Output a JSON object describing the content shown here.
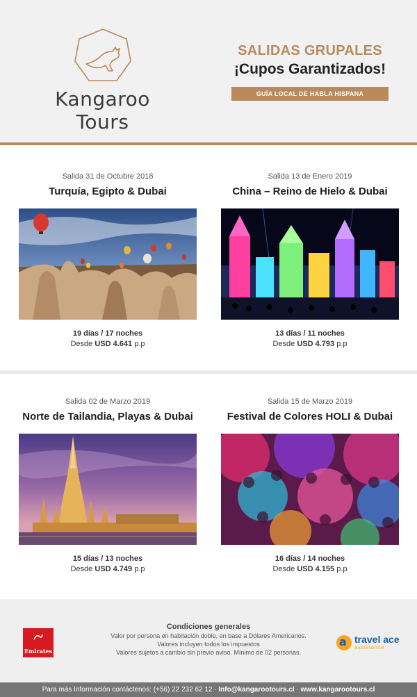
{
  "brand": {
    "name": "Kangaroo Tours"
  },
  "promo": {
    "title": "SALIDAS GRUPALES",
    "subtitle": "¡Cupos Garantizados!",
    "badge": "GUÍA LOCAL DE HABLA HISPANA"
  },
  "tours": [
    {
      "date": "Salida 31 de Octubre 2018",
      "title": "Turquía, Egipto & Dubai",
      "duration": "19 días / 17 noches",
      "price_prefix": "Desde",
      "price": "USD 4.641",
      "price_suffix": "p.p",
      "image": "cappadocia-balloons"
    },
    {
      "date": "Salida 13 de Enero 2019",
      "title": "China – Reino de Hielo & Dubai",
      "duration": "13 días / 11 noches",
      "price_prefix": "Desde",
      "price": "USD 4.793",
      "price_suffix": "p.p",
      "image": "ice-castle-night"
    },
    {
      "date": "Salida 02 de Marzo 2019",
      "title": "Norte de Tailandia, Playas & Dubai",
      "duration": "15 días / 13 noches",
      "price_prefix": "Desde",
      "price": "USD 4.749",
      "price_suffix": "p.p",
      "image": "thai-temple-dusk"
    },
    {
      "date": "Salida 15 de Marzo 2019",
      "title": "Festival de Colores HOLI & Dubai",
      "duration": "16 días / 14 noches",
      "price_prefix": "Desde",
      "price": "USD 4.155",
      "price_suffix": "p.p",
      "image": "holi-color-crowd"
    }
  ],
  "conditions": {
    "title": "Condiciones generales",
    "lines": [
      "Valor por persona en habitación doble, en base a Dólares Americanos.",
      "Valores incluyen todos los impuestos",
      "Valores sujetos a cambio sin previo aviso. Mínimo de 02 personas."
    ]
  },
  "partners": {
    "airline": "Emirates",
    "assistance_name": "travel ace",
    "assistance_sub": "assistance"
  },
  "contact": {
    "prefix": "Para más Información contáctenos:",
    "phone": "(+56) 22 232 62 12",
    "email": "Info@kangarootours.cl",
    "web": "www.kangarootours.cl",
    "separator": "·"
  },
  "colors": {
    "accent": "#b8895a",
    "footer_bar": "#757575"
  }
}
